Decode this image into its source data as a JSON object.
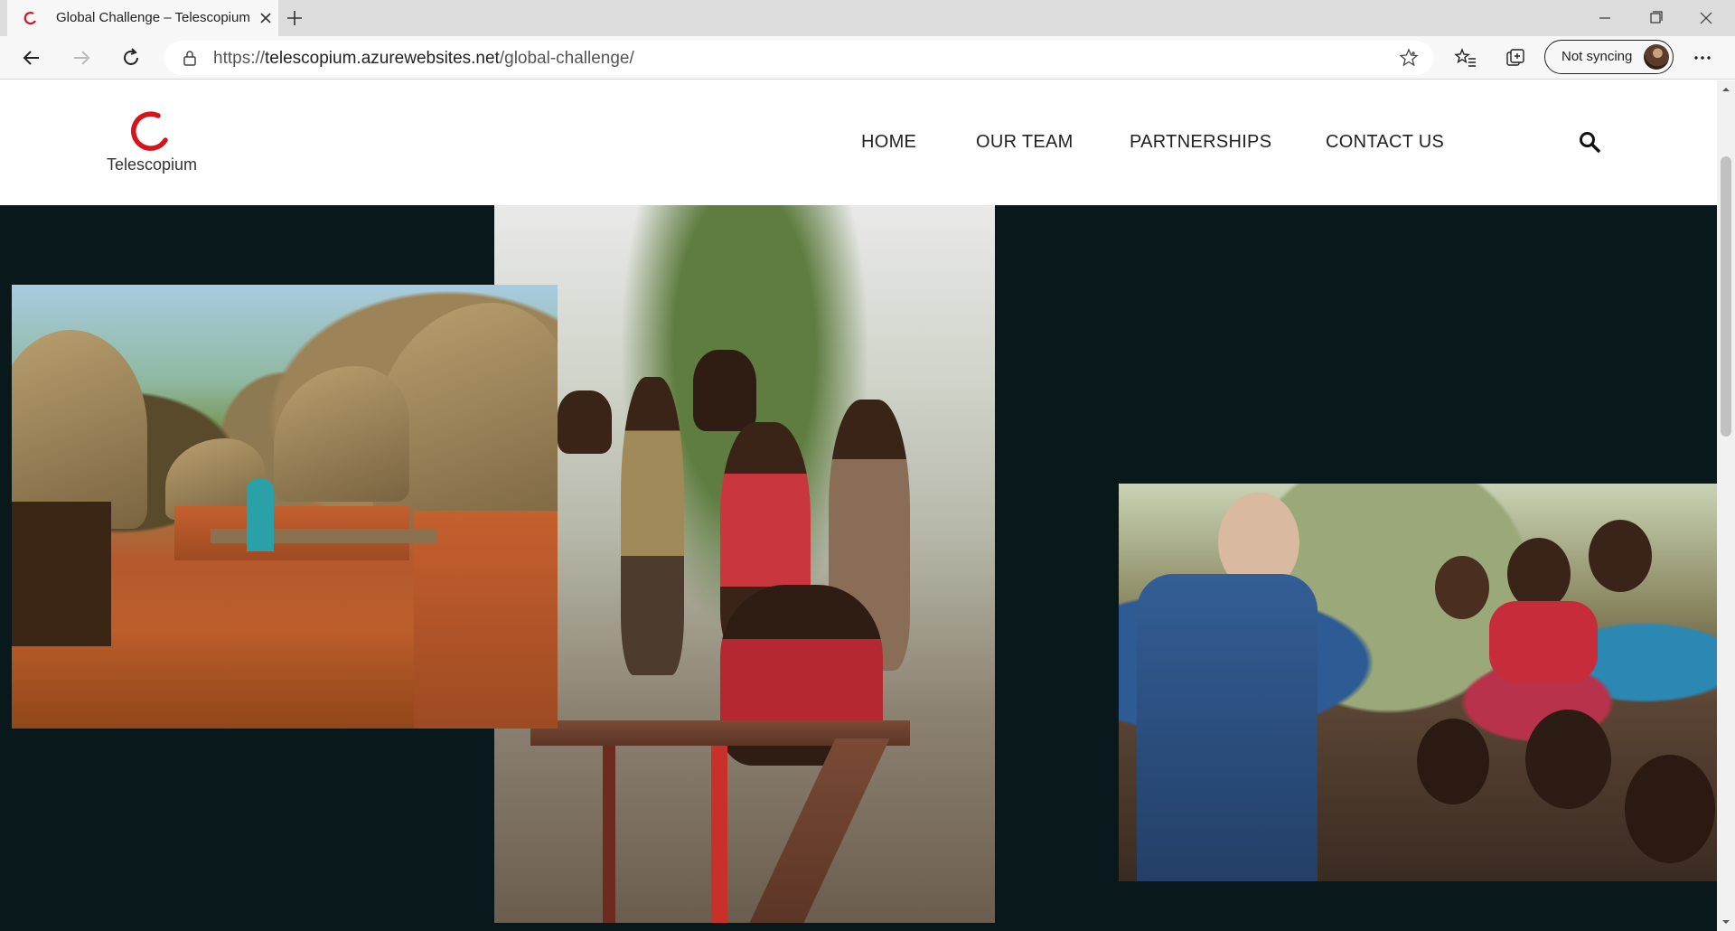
{
  "browser": {
    "tab": {
      "title": "Global Challenge – Telescopium"
    },
    "address": {
      "scheme": "https://",
      "host": "telescopium.azurewebsites.net",
      "path": "/global-challenge/"
    },
    "profile": {
      "label": "Not syncing"
    }
  },
  "site": {
    "logo_text": "Telescopium",
    "nav": {
      "home": "HOME",
      "team": "OUR TEAM",
      "partnerships": "PARTNERSHIPS",
      "contact": "CONTACT US"
    }
  },
  "colors": {
    "brand_red": "#d4161b",
    "page_background": "#08181b"
  },
  "photos": [
    {
      "name": "village-huts-photo",
      "icon": "photo"
    },
    {
      "name": "children-on-slide-photo",
      "icon": "photo"
    },
    {
      "name": "crowd-greeting-photo",
      "icon": "photo"
    }
  ]
}
